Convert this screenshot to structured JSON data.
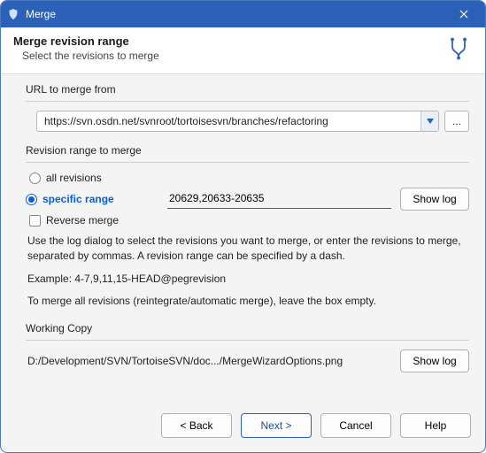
{
  "window": {
    "title": "Merge"
  },
  "header": {
    "title": "Merge revision range",
    "subtitle": "Select the revisions to merge"
  },
  "url_section": {
    "label": "URL to merge from",
    "value": "https://svn.osdn.net/svnroot/tortoisesvn/branches/refactoring",
    "browse_label": "..."
  },
  "range_section": {
    "label": "Revision range to merge",
    "all_label": "all revisions",
    "specific_label": "specific range",
    "selected": "specific",
    "range_value": "20629,20633-20635",
    "show_log_label": "Show log",
    "reverse_label": "Reverse merge",
    "reverse_checked": false,
    "help1": "Use the log dialog to select the revisions you want to merge, or enter the revisions to merge, separated by commas. A revision range can be specified by a dash.",
    "help2": "Example: 4-7,9,11,15-HEAD@pegrevision",
    "help3": "To merge all revisions (reintegrate/automatic merge), leave the box empty."
  },
  "wc_section": {
    "label": "Working Copy",
    "path": "D:/Development/SVN/TortoiseSVN/doc.../MergeWizardOptions.png",
    "show_log_label": "Show log"
  },
  "footer": {
    "back": "< Back",
    "next": "Next >",
    "cancel": "Cancel",
    "help": "Help"
  }
}
